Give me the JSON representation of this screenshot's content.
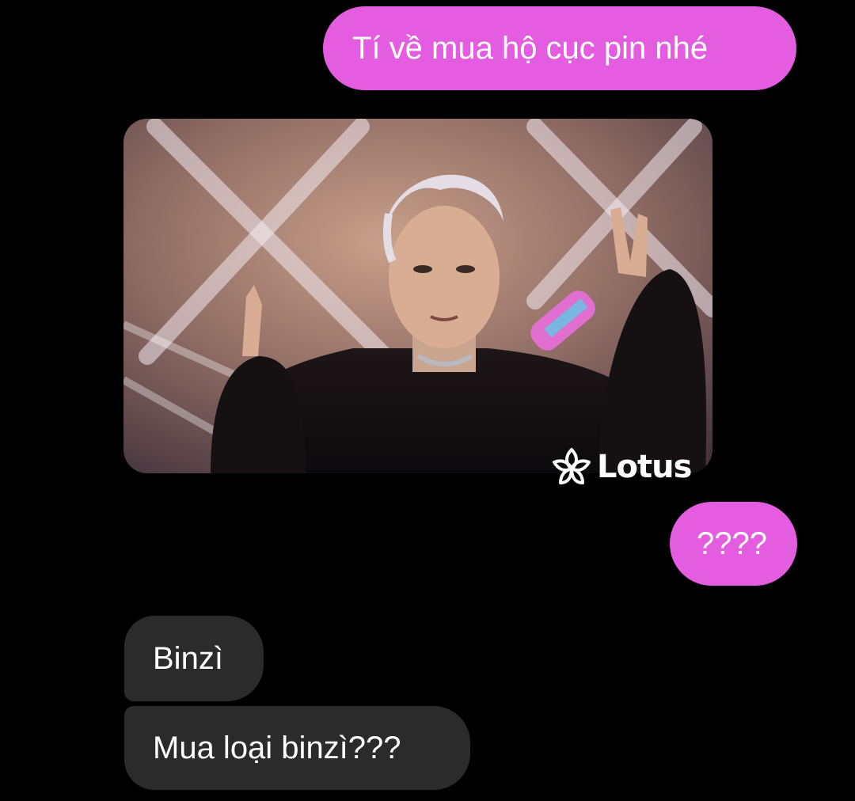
{
  "conversation": {
    "messages": [
      {
        "direction": "outgoing",
        "type": "text",
        "text": "Tí về mua hộ cục pin nhé"
      },
      {
        "direction": "incoming",
        "type": "image",
        "image_description": "man with silver hair in black fur coat holding microphone, making hand gestures on stage"
      },
      {
        "direction": "outgoing",
        "type": "text",
        "text": "????"
      },
      {
        "direction": "incoming",
        "type": "text",
        "text": "Binzì"
      },
      {
        "direction": "incoming",
        "type": "text",
        "text": "Mua loại binzì???"
      }
    ]
  },
  "watermark": {
    "text": "Lotus",
    "icon": "lotus-flower-icon"
  },
  "colors": {
    "background": "#000000",
    "outgoing_bubble": "#e45ce0",
    "incoming_bubble": "#2b2b2b",
    "text": "#ffffff"
  }
}
